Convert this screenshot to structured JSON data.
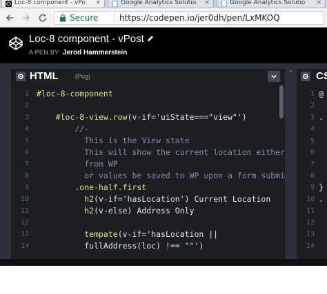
{
  "browser": {
    "tabs": [
      {
        "label": "Loc-8 component - vPo",
        "close": "×"
      },
      {
        "label": "Google Analytics Solutio",
        "close": "×"
      },
      {
        "label": "Google Analytics Solutio",
        "close": "×"
      }
    ],
    "secure_label": "Secure",
    "url": "https://codepen.io/jer0dh/pen/LxMKOQ"
  },
  "pen": {
    "title": "Loc-8 component - vPost",
    "pen_by_label": "A PEN BY",
    "author": "Jerod Hammerstein"
  },
  "editor_html": {
    "language": "HTML",
    "preprocessor": "(Pug)",
    "lines": [
      {
        "num": "1",
        "tokens": [
          {
            "t": "#loc-8-component",
            "c": "tag"
          }
        ]
      },
      {
        "num": "2",
        "tokens": []
      },
      {
        "num": "3",
        "tokens": [
          {
            "t": "    #loc-8-view.row",
            "c": "tag"
          },
          {
            "t": "(v-if='uiState===\"view\"')",
            "c": "txt"
          }
        ]
      },
      {
        "num": "4",
        "tokens": [
          {
            "t": "        //-",
            "c": "com"
          }
        ]
      },
      {
        "num": "5",
        "tokens": [
          {
            "t": "          This is the View state",
            "c": "com"
          }
        ]
      },
      {
        "num": "6",
        "tokens": [
          {
            "t": "          This will show the current location either",
            "c": "com"
          }
        ]
      },
      {
        "num": "7",
        "tokens": [
          {
            "t": "          from WP",
            "c": "com"
          }
        ]
      },
      {
        "num": "8",
        "tokens": [
          {
            "t": "          or values be saved to WP upon a form submit",
            "c": "com"
          }
        ]
      },
      {
        "num": "9",
        "tokens": [
          {
            "t": "        .one-half.first",
            "c": "tag"
          }
        ]
      },
      {
        "num": "10",
        "tokens": [
          {
            "t": "          h2",
            "c": "tag"
          },
          {
            "t": "(v-if='hasLocation') ",
            "c": "txt"
          },
          {
            "t": "Current Location",
            "c": "str"
          }
        ]
      },
      {
        "num": "11",
        "tokens": [
          {
            "t": "          h2",
            "c": "tag"
          },
          {
            "t": "(v-else) ",
            "c": "txt"
          },
          {
            "t": "Address Only",
            "c": "str"
          }
        ]
      },
      {
        "num": "12",
        "tokens": []
      },
      {
        "num": "13",
        "tokens": [
          {
            "t": "          tempate",
            "c": "tag"
          },
          {
            "t": "(v-if='hasLocation ||",
            "c": "txt"
          }
        ]
      },
      {
        "num": "14",
        "tokens": [
          {
            "t": "          fullAddress(loc) !== \"\"')",
            "c": "txt"
          }
        ]
      }
    ]
  },
  "editor_css": {
    "language": "CS",
    "lines": [
      {
        "num": "1",
        "text": "@",
        "color": "#dde2f7"
      },
      {
        "num": "2",
        "text": "",
        "color": "#dde2f7"
      },
      {
        "num": "3",
        "text": ".",
        "color": "#dde584"
      },
      {
        "num": "4",
        "text": "",
        "color": "#dde2f7"
      },
      {
        "num": "5",
        "text": "",
        "color": "#dde2f7"
      },
      {
        "num": "6",
        "text": "",
        "color": "#dde2f7"
      },
      {
        "num": "7",
        "text": "",
        "color": "#dde2f7"
      },
      {
        "num": "8",
        "text": "",
        "color": "#dde2f7"
      },
      {
        "num": "9",
        "text": "}",
        "color": "#dde2f7"
      },
      {
        "num": "10",
        "text": ".",
        "color": "#dde584"
      },
      {
        "num": "11",
        "text": "",
        "color": "#dde2f7"
      },
      {
        "num": "12",
        "text": "",
        "color": "#dde2f7"
      },
      {
        "num": "13",
        "text": "",
        "color": "#dde2f7"
      },
      {
        "num": "14",
        "text": "",
        "color": "#dde2f7"
      }
    ]
  },
  "colors": {
    "header_bg": "#000000",
    "editor_bg": "#1d1e22",
    "gutter_bg": "#2c303a",
    "secure_green": "#0b8043",
    "pug_tag": "#dde584",
    "pug_comment": "#838bb0"
  },
  "icons": [
    "back-icon",
    "forward-icon",
    "reload-icon",
    "lock-icon",
    "codepen-logo-icon",
    "pencil-icon",
    "gear-icon",
    "chevron-down-icon",
    "close-icon"
  ]
}
